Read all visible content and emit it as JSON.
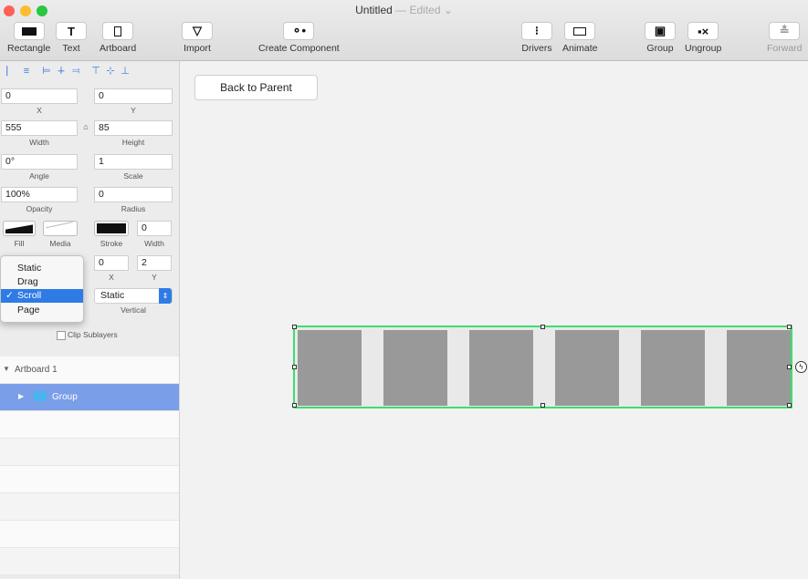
{
  "window": {
    "title": "Untitled",
    "status": "— Edited ⌄"
  },
  "toolbar": {
    "rectangle": "Rectangle",
    "text": "Text",
    "artboard": "Artboard",
    "import": "Import",
    "create_component": "Create Component",
    "drivers": "Drivers",
    "animate": "Animate",
    "group": "Group",
    "ungroup": "Ungroup",
    "forward": "Forward",
    "text_icon": "T"
  },
  "inspector": {
    "x": "0",
    "x_label": "X",
    "y": "0",
    "y_label": "Y",
    "width": "555",
    "width_label": "Width",
    "height": "85",
    "height_label": "Height",
    "angle": "0°",
    "angle_label": "Angle",
    "scale": "1",
    "scale_label": "Scale",
    "opacity": "100%",
    "opacity_label": "Opacity",
    "radius": "0",
    "radius_label": "Radius",
    "fill_label": "Fill",
    "media_label": "Media",
    "stroke_label": "Stroke",
    "stroke_width": "0",
    "stroke_width_label": "Width",
    "content_x": "0",
    "content_x_label": "X",
    "content_y": "2",
    "content_y_label": "Y",
    "vertical_value": "Static",
    "vertical_label": "Vertical",
    "clip_label": "Clip Sublayers"
  },
  "behavior_menu": {
    "options": [
      "Static",
      "Drag",
      "Scroll",
      "Page"
    ],
    "selected": "Scroll",
    "check": "✓"
  },
  "layers": {
    "artboard": "Artboard 1",
    "group": "Group"
  },
  "canvas": {
    "back_button": "Back to Parent"
  }
}
